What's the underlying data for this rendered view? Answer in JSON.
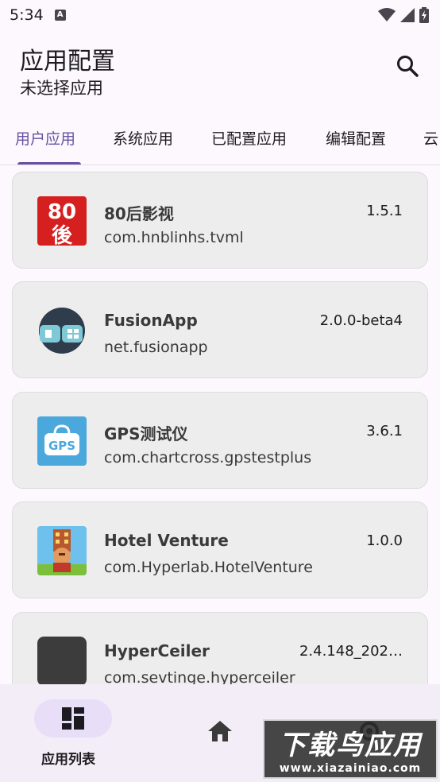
{
  "status_bar": {
    "time": "5:34",
    "notification_icon": "a-box-icon",
    "wifi_icon": "wifi-icon",
    "signal_icon": "signal-icon",
    "battery_icon": "battery-charging-icon"
  },
  "header": {
    "title": "应用配置",
    "subtitle": "未选择应用",
    "search_icon": "search-icon"
  },
  "tabs": [
    {
      "label": "用户应用",
      "active": true
    },
    {
      "label": "系统应用",
      "active": false
    },
    {
      "label": "已配置应用",
      "active": false
    },
    {
      "label": "编辑配置",
      "active": false
    },
    {
      "label": "云",
      "active": false
    }
  ],
  "apps": [
    {
      "name": "80后影视",
      "package": "com.hnblinhs.tvml",
      "version": "1.5.1",
      "icon": "eighties-icon"
    },
    {
      "name": "FusionApp",
      "package": "net.fusionapp",
      "version": "2.0.0-beta4",
      "icon": "fusionapp-icon"
    },
    {
      "name": "GPS测试仪",
      "package": "com.chartcross.gpstestplus",
      "version": "3.6.1",
      "icon": "gps-icon"
    },
    {
      "name": "Hotel Venture",
      "package": "com.Hyperlab.HotelVenture",
      "version": "1.0.0",
      "icon": "hotel-venture-icon"
    },
    {
      "name": "HyperCeiler",
      "package": "com.sevtinge.hyperceiler",
      "version": "2.4.148_202…",
      "icon": "hyperceiler-icon"
    }
  ],
  "bottom_nav": {
    "items": [
      {
        "label": "应用列表",
        "icon": "dashboard-icon",
        "active": true
      },
      {
        "label": "",
        "icon": "home-icon",
        "active": false
      },
      {
        "label": "",
        "icon": "settings-icon",
        "active": false
      }
    ]
  },
  "watermark": {
    "main": "下载鸟应用",
    "sub": "www.xiazainiao.com"
  },
  "colors": {
    "accent": "#6750a4",
    "card_bg": "#ededed",
    "nav_bg": "#f3edf7",
    "nav_pill": "#e8def8"
  }
}
